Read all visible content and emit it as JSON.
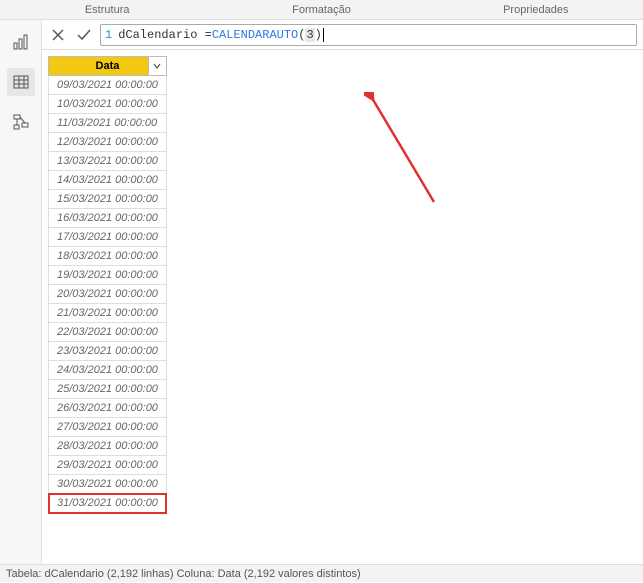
{
  "ribbon": {
    "tabs": [
      "Estrutura",
      "Formatação",
      "Propriedades"
    ]
  },
  "view_switcher": {
    "items": [
      {
        "name": "report",
        "icon": "chart"
      },
      {
        "name": "data",
        "icon": "table",
        "active": true
      },
      {
        "name": "model",
        "icon": "model"
      }
    ]
  },
  "formula": {
    "line_no": "1",
    "prefix": "dCalendario = ",
    "function": "CALENDARAUTO",
    "arg": "3"
  },
  "table": {
    "column_header": "Data",
    "rows": [
      "09/03/2021 00:00:00",
      "10/03/2021 00:00:00",
      "11/03/2021 00:00:00",
      "12/03/2021 00:00:00",
      "13/03/2021 00:00:00",
      "14/03/2021 00:00:00",
      "15/03/2021 00:00:00",
      "16/03/2021 00:00:00",
      "17/03/2021 00:00:00",
      "18/03/2021 00:00:00",
      "19/03/2021 00:00:00",
      "20/03/2021 00:00:00",
      "21/03/2021 00:00:00",
      "22/03/2021 00:00:00",
      "23/03/2021 00:00:00",
      "24/03/2021 00:00:00",
      "25/03/2021 00:00:00",
      "26/03/2021 00:00:00",
      "27/03/2021 00:00:00",
      "28/03/2021 00:00:00",
      "29/03/2021 00:00:00",
      "30/03/2021 00:00:00",
      "31/03/2021 00:00:00"
    ],
    "highlight_last": true
  },
  "status": "Tabela: dCalendario (2,192 linhas) Coluna: Data (2,192 valores distintos)",
  "colors": {
    "accent": "#f2c811",
    "highlight": "#e03030"
  }
}
